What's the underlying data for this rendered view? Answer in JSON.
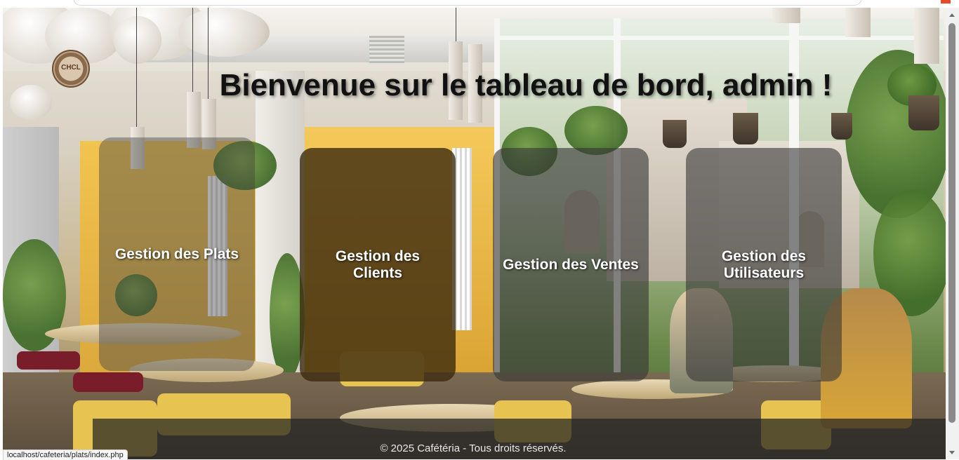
{
  "page": {
    "title": "Bienvenue sur le tableau de bord, admin !",
    "logo_text": "CHCL"
  },
  "cards": [
    {
      "label": "Gestion des Plats"
    },
    {
      "label": "Gestion des Clients"
    },
    {
      "label": "Gestion des Ventes"
    },
    {
      "label": "Gestion des Utilisateurs"
    }
  ],
  "footer": {
    "text": "© 2025 Cafétéria - Tous droits réservés."
  },
  "status_bar": {
    "url": "localhost/cafeteria/plats/index.php"
  },
  "colors": {
    "title": "#111111",
    "card_text": "#ffffff",
    "footer_bg": "#232323"
  },
  "icons": [
    "logo-badge",
    "scroll-up-arrow",
    "scroll-down-arrow"
  ]
}
